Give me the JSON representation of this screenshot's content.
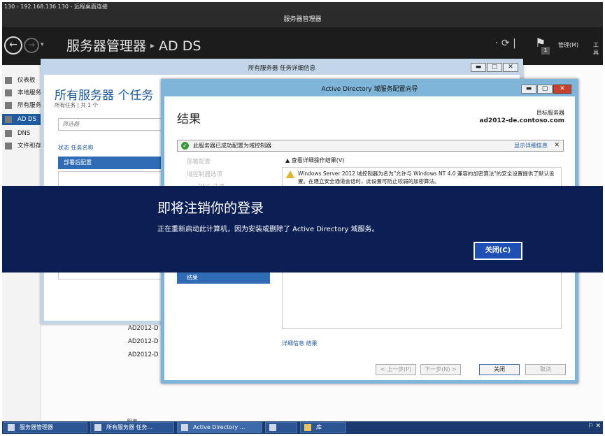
{
  "rdp": {
    "title": "130 - 192.168.136.130 - 远程桌面连接"
  },
  "window": {
    "title": "服务器管理器"
  },
  "header": {
    "app_name": "服务器管理器",
    "separator": "▸",
    "section": "AD DS",
    "nav_back": "←",
    "nav_forward": "→",
    "nav_dropdown": "▾",
    "refresh": "· ⟳ |",
    "flag": "⚑",
    "notifications": "1",
    "manage_menu": "管理(M)",
    "tools_menu": "工具"
  },
  "sidebar": {
    "items": [
      {
        "label": "仪表板",
        "icon": "dashboard-icon"
      },
      {
        "label": "本地服务器",
        "icon": "server-icon"
      },
      {
        "label": "所有服务器",
        "icon": "servers-icon"
      },
      {
        "label": "AD DS",
        "icon": "ad-ds-icon"
      },
      {
        "label": "DNS",
        "icon": "dns-icon"
      },
      {
        "label": "文件和存储服务",
        "icon": "file-storage-icon"
      }
    ]
  },
  "background": {
    "server_rows": [
      "AD2012-D",
      "AD2012-D",
      "AD2012-D"
    ],
    "services_label": "服务"
  },
  "task_window": {
    "title": "所有服务器 任务详细信息",
    "heading": "所有服务器 个任务",
    "count": "所有任务 | 共 1 个",
    "filter_placeholder": "筛选器",
    "columns": "状态   任务名称",
    "row": "部署后配置"
  },
  "wizard": {
    "title": "Active Directory 域服务配置向导",
    "heading": "结果",
    "target_label": "目标服务器",
    "target_value": "ad2012-de.contoso.com",
    "success_message": "此服务器已成功配置为域控制器",
    "show_details": "显示详细信息",
    "success_close": "✕",
    "steps": [
      "部署配置",
      "域控制器选项",
      "DNS 选项"
    ],
    "active_step": "结果",
    "view_results": "▲ 查看详细操作结果(V)",
    "warning_text": "Windows Server 2012 域控制器为名为\"允许与 Windows NT 4.0 兼容的加密算法\"的安全设置提供了默认设置。在建立安全通道会话时，此设置可防止较弱的加密算法。",
    "more_info": "详细信息 结果",
    "buttons": {
      "prev": "< 上一步(P)",
      "next": "下一步(N) >",
      "install": "关闭",
      "cancel": "取消"
    }
  },
  "overlay": {
    "title": "即将注销你的登录",
    "message": "正在重新启动此计算机，因为安装或删除了 Active Directory 域服务。",
    "close_button": "关闭(C)"
  },
  "taskbar": {
    "items": [
      "服务器管理器",
      "所有服务器 任务...",
      "Active Directory ...",
      "",
      "库"
    ],
    "tray": "⚐ ✕"
  }
}
